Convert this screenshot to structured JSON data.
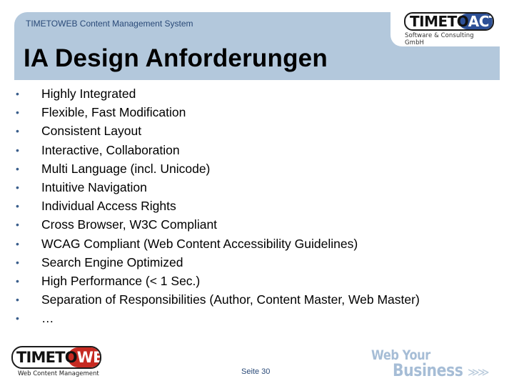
{
  "header": {
    "subtitle": "TIMETOWEB Content Management System",
    "title": "IA Design Anforderungen",
    "band_color": "#b3c8dc"
  },
  "logos": {
    "top_right": {
      "name_part1": "TIMETO",
      "name_part2": "ACT",
      "tagline": "Software & Consulting GmbH",
      "accent": "#2d5096"
    },
    "bottom_left": {
      "name_part1": "TIMETO",
      "name_part2": "WEB",
      "tagline": "Web Content Management",
      "accent": "#c62a22"
    }
  },
  "bullet_glyph": "•",
  "bullets": [
    "Highly Integrated",
    "Flexible, Fast Modification",
    "Consistent Layout",
    "Interactive, Collaboration",
    "Multi Language (incl. Unicode)",
    "Intuitive Navigation",
    "Individual Access Rights",
    "Cross Browser, W3C Compliant",
    "WCAG Compliant (Web Content Accessibility Guidelines)",
    "Search Engine Optimized",
    "High Performance (< 1 Sec.)",
    "Separation of Responsibilities (Author, Content Master, Web Master)",
    "…"
  ],
  "footer": {
    "page_number": "Seite 30",
    "slogan_line1": "Web Your",
    "slogan_line2": "Business",
    "slogan_arrows": "≫≫"
  }
}
